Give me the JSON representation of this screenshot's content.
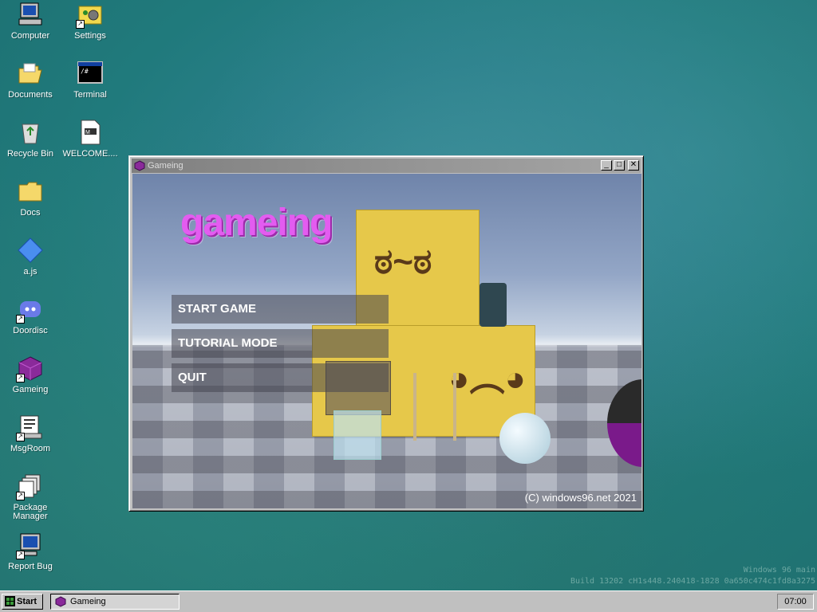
{
  "desktop": {
    "icons": [
      {
        "label": "Computer",
        "icon": "computer-icon"
      },
      {
        "label": "Settings",
        "icon": "settings-icon"
      },
      {
        "label": "Documents",
        "icon": "folder-open-icon"
      },
      {
        "label": "Terminal",
        "icon": "terminal-icon"
      },
      {
        "label": "Recycle Bin",
        "icon": "recycle-bin-icon"
      },
      {
        "label": "WELCOME....",
        "icon": "document-icon"
      },
      {
        "label": "Docs",
        "icon": "folder-icon"
      },
      {
        "label": "a.js",
        "icon": "js-file-icon"
      },
      {
        "label": "Doordisc",
        "icon": "discord-icon"
      },
      {
        "label": "Gameing",
        "icon": "gameing-cube-icon"
      },
      {
        "label": "MsgRoom",
        "icon": "msgroom-icon"
      },
      {
        "label": "Package Manager",
        "icon": "package-manager-icon"
      },
      {
        "label": "Report Bug",
        "icon": "report-bug-icon"
      }
    ],
    "build_line1": "Windows 96 main",
    "build_line2": "Build 13202 cH1s448.240418-1828 0a650c474c1fd8a3275"
  },
  "window": {
    "title": "Gameing",
    "minimize_label": "_",
    "maximize_label": "□",
    "close_label": "✕",
    "game": {
      "title": "gameing",
      "menu": [
        "START GAME",
        "TUTORIAL MODE",
        "QUIT"
      ],
      "copyright": "(C) windows96.net 2021"
    }
  },
  "taskbar": {
    "start_label": "Start",
    "task_label": "Gameing",
    "clock": "07:00"
  },
  "colors": {
    "title_pink": "#e35cf0",
    "desktop_teal": "#2a7f8a",
    "box_yellow": "#e6c84a"
  }
}
